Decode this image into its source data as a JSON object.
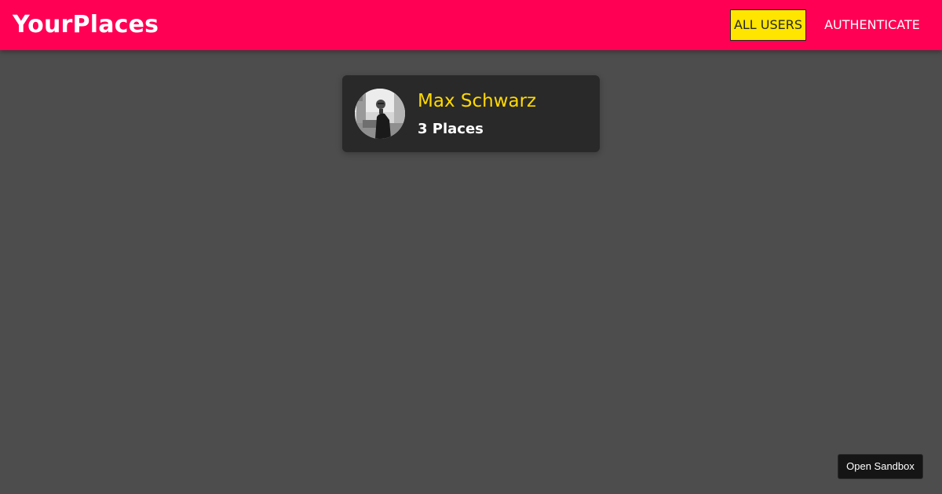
{
  "header": {
    "brand": "YourPlaces",
    "nav": [
      {
        "label": "ALL USERS",
        "active": true
      },
      {
        "label": "AUTHENTICATE",
        "active": false
      }
    ]
  },
  "users": [
    {
      "name": "Max Schwarz",
      "places": "3 Places"
    }
  ],
  "sandbox": {
    "label": "Open Sandbox"
  },
  "colors": {
    "header_bg": "#ff0055",
    "page_bg": "#4d4d4d",
    "card_bg": "#292929",
    "name_color": "#ffd900",
    "active_nav_bg": "#ffe500"
  }
}
